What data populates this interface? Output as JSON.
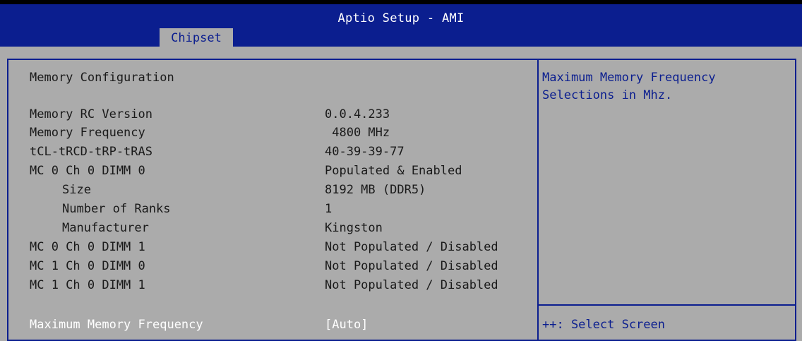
{
  "header": {
    "title": "Aptio Setup - AMI",
    "tab": "Chipset"
  },
  "section_title": "Memory Configuration",
  "rows": [
    {
      "label": "Memory RC Version",
      "value": "0.0.4.233"
    },
    {
      "label": "Memory Frequency",
      "value": " 4800 MHz"
    },
    {
      "label": "tCL-tRCD-tRP-tRAS",
      "value": "40-39-39-77"
    },
    {
      "label": "MC 0 Ch 0 DIMM 0",
      "value": "Populated & Enabled"
    },
    {
      "label": "Size",
      "value": "8192 MB (DDR5)"
    },
    {
      "label": "Number of Ranks",
      "value": "1"
    },
    {
      "label": "Manufacturer",
      "value": "Kingston"
    },
    {
      "label": "MC 0 Ch 0 DIMM 1",
      "value": "Not Populated / Disabled"
    },
    {
      "label": "MC 1 Ch 0 DIMM 0",
      "value": "Not Populated / Disabled"
    },
    {
      "label": "MC 1 Ch 0 DIMM 1",
      "value": "Not Populated / Disabled"
    }
  ],
  "selected": {
    "label": "Maximum Memory Frequency",
    "value": "[Auto]"
  },
  "help": {
    "line1": "Maximum Memory Frequency",
    "line2": "Selections in Mhz."
  },
  "keys": {
    "select_screen": "++: Select Screen"
  }
}
